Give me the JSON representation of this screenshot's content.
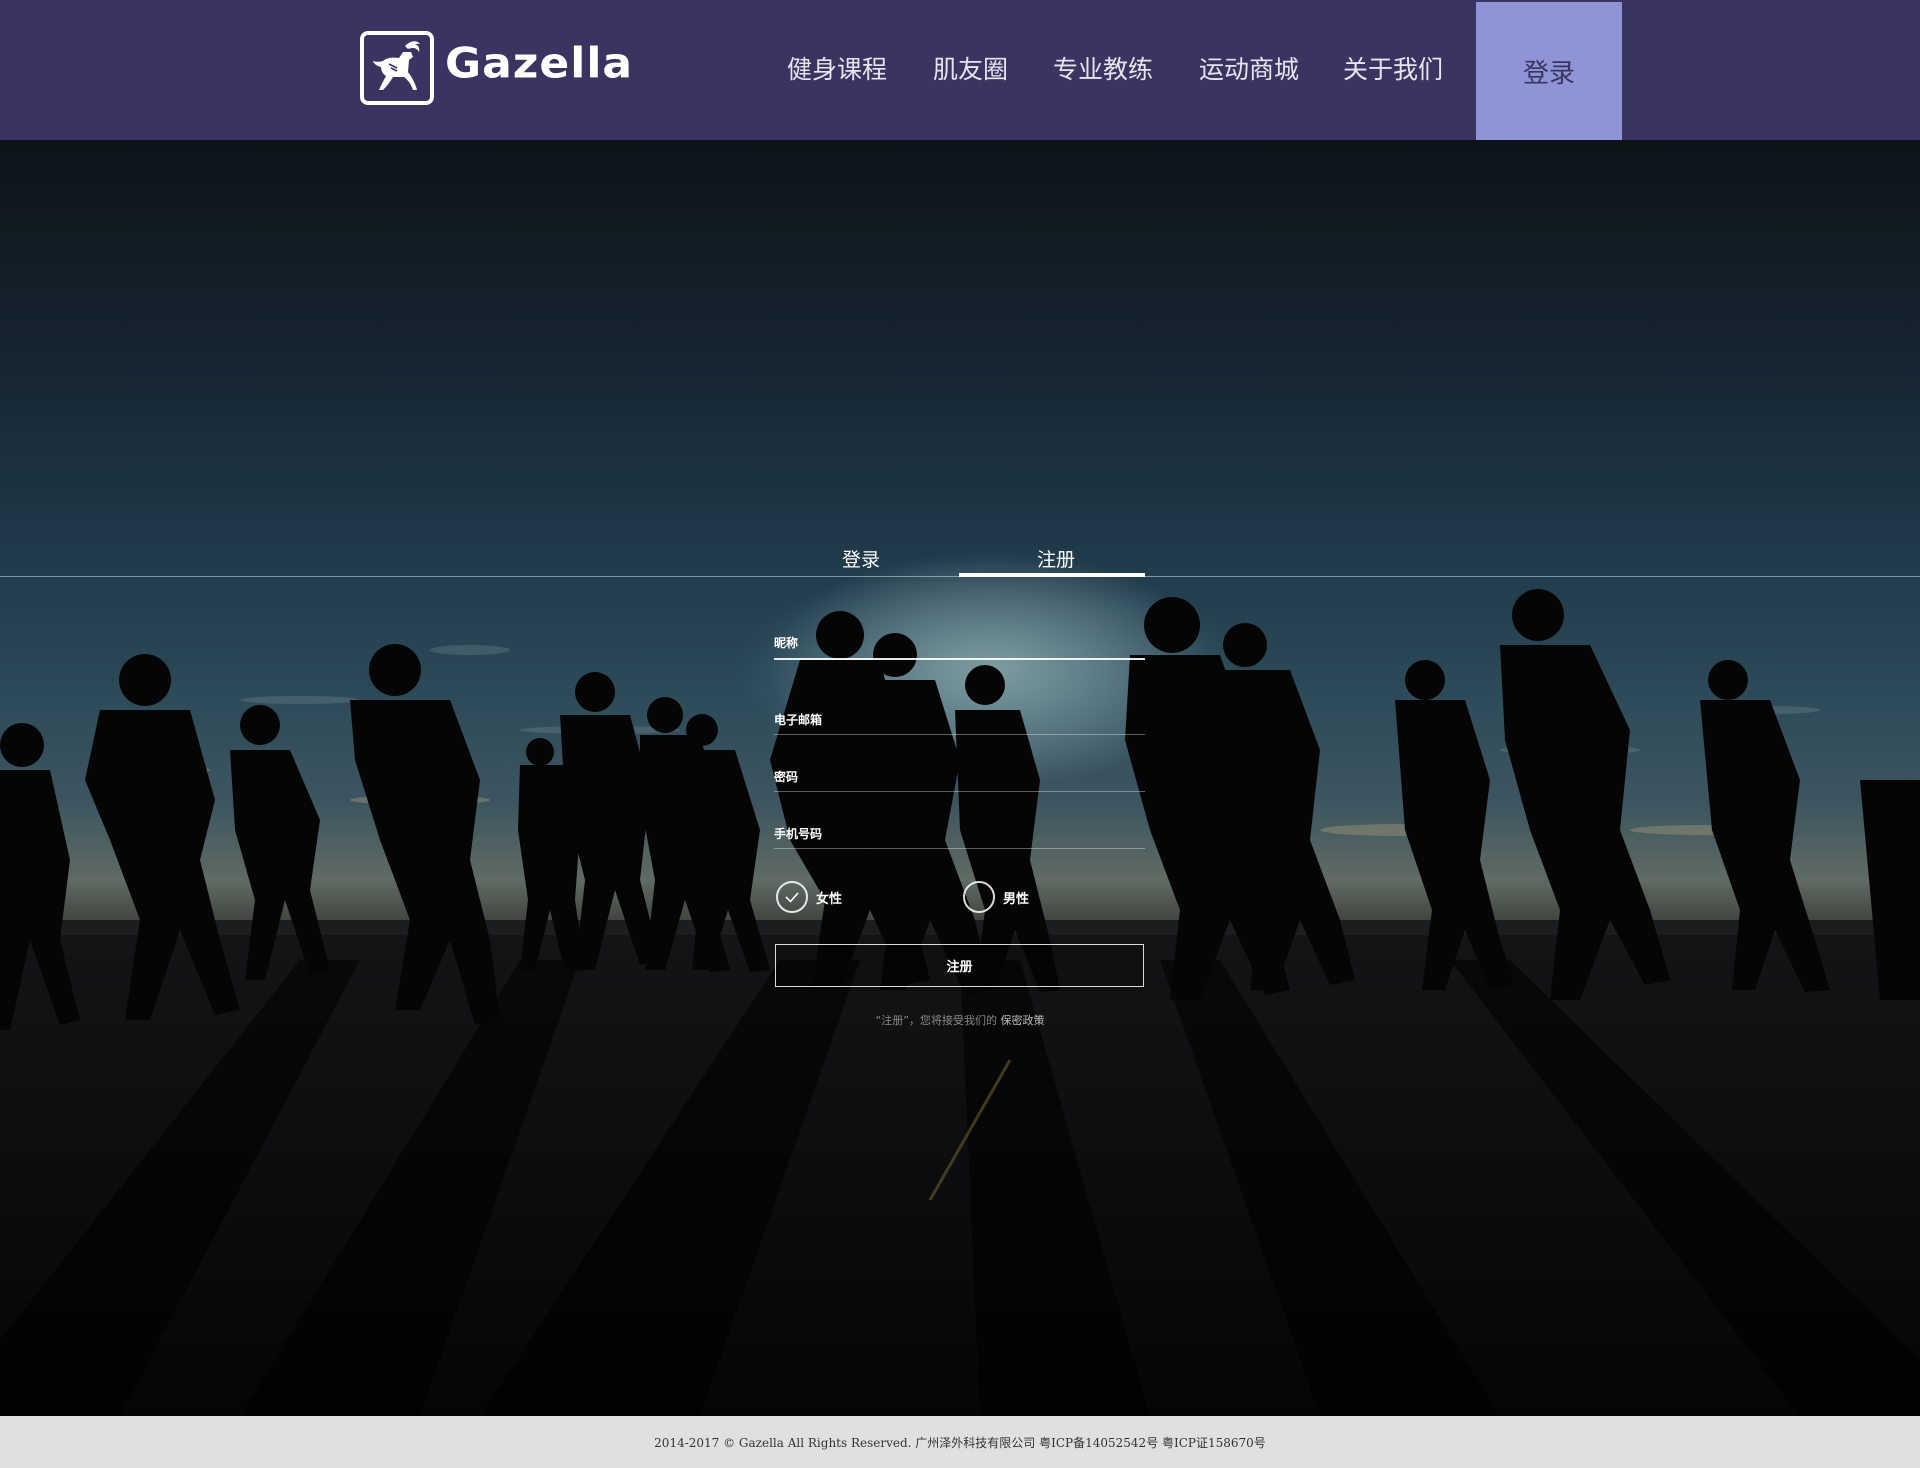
{
  "brand": {
    "name": "Gazella"
  },
  "nav": {
    "items": [
      {
        "label": "健身课程"
      },
      {
        "label": "肌友圈"
      },
      {
        "label": "专业教练"
      },
      {
        "label": "运动商城"
      },
      {
        "label": "关于我们"
      }
    ],
    "login_label": "登录"
  },
  "auth": {
    "tabs": [
      {
        "label": "登录",
        "active": false
      },
      {
        "label": "注册",
        "active": true
      }
    ],
    "fields": [
      {
        "label": "昵称",
        "value": ""
      },
      {
        "label": "电子邮箱",
        "value": ""
      },
      {
        "label": "密码",
        "value": ""
      },
      {
        "label": "手机号码",
        "value": ""
      }
    ],
    "gender": {
      "options": [
        {
          "label": "女性",
          "selected": true
        },
        {
          "label": "男性",
          "selected": false
        }
      ]
    },
    "submit_label": "注册",
    "policy": {
      "text": "“注册”，您将接受我们的",
      "link": "保密政策"
    }
  },
  "footer": {
    "text": "2014-2017 © Gazella All Rights Reserved. 广州泽外科技有限公司 粤ICP备14052542号 粤ICP证158670号"
  },
  "colors": {
    "header_bg": "#3a3460",
    "login_button_bg": "#8e94d6",
    "footer_bg": "#e0e0e0"
  }
}
